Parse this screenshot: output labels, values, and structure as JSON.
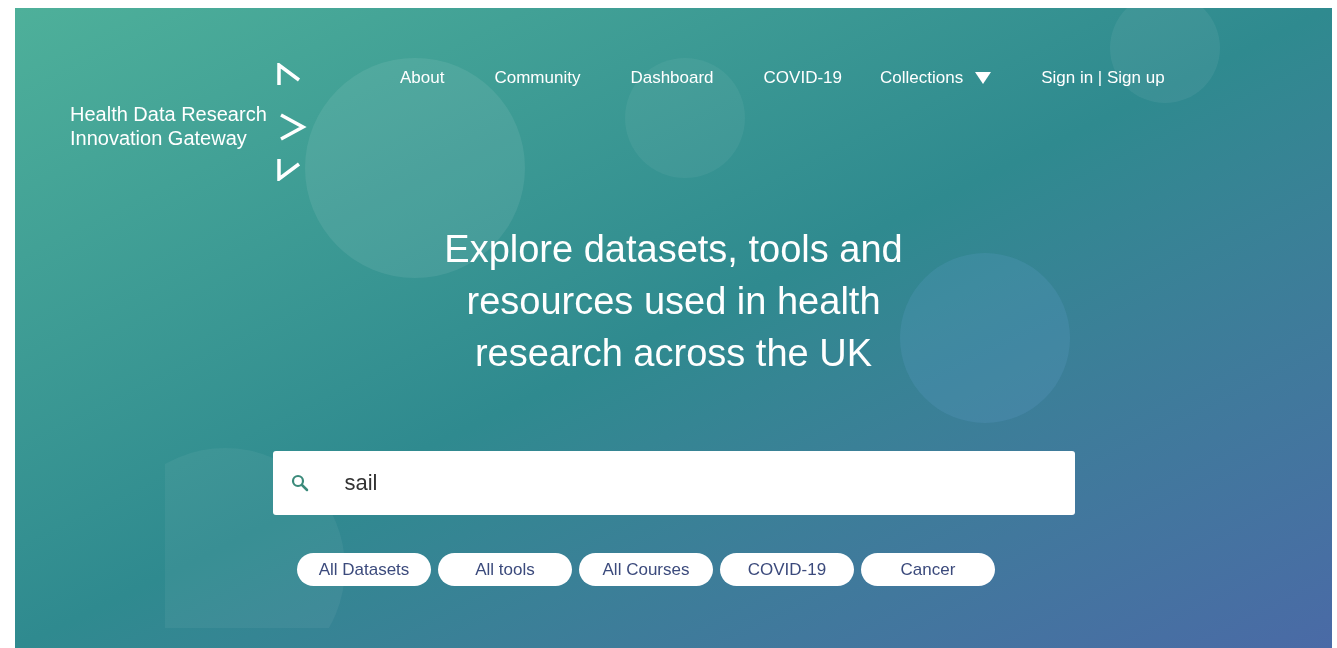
{
  "logo": {
    "line_1": "Health Data Research",
    "line_2": "Innovation Gateway"
  },
  "nav": [
    {
      "label": "About",
      "kind": "link"
    },
    {
      "label": "Community",
      "kind": "link"
    },
    {
      "label": "Dashboard",
      "kind": "link"
    },
    {
      "label": "COVID-19",
      "kind": "link"
    },
    {
      "label": "Collections",
      "kind": "dropdown"
    },
    {
      "label": "Sign in | Sign up",
      "kind": "link"
    }
  ],
  "headline": "Explore datasets, tools and resources used in health research across the UK",
  "search": {
    "value": "sail"
  },
  "chips": [
    "All Datasets",
    "All tools",
    "All Courses",
    "COVID-19",
    "Cancer"
  ]
}
